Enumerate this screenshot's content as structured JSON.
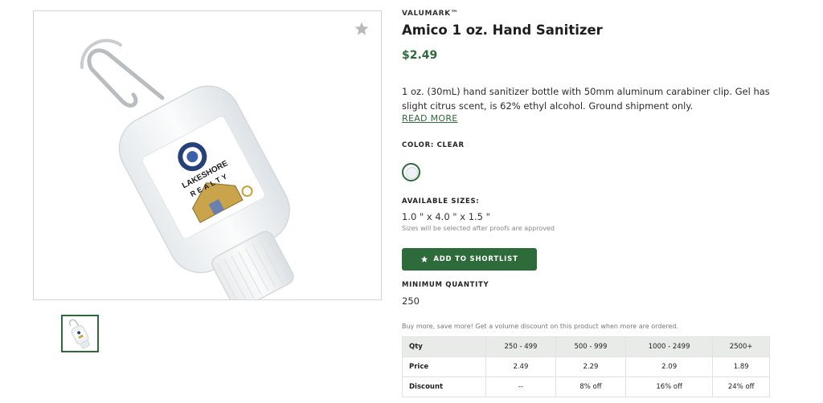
{
  "product": {
    "brand": "VALUMARK™",
    "title": "Amico 1 oz. Hand Sanitizer",
    "price": "$2.49",
    "description": "1 oz. (30mL) hand sanitizer bottle with 50mm aluminum carabiner clip. Gel has slight citrus scent, is 62% ethyl alcohol. Ground shipment only.",
    "read_more": "READ MORE",
    "image_logo_text_top": "LAKESHORE",
    "image_logo_text_bottom": "REALTY"
  },
  "color": {
    "label": "COLOR: CLEAR",
    "swatch_color": "#eef2f4"
  },
  "sizes": {
    "label": "AVAILABLE SIZES:",
    "value": "1.0 \" x 4.0 \" x 1.5 \"",
    "note": "Sizes will be selected after proofs are approved"
  },
  "actions": {
    "add_to_shortlist": "ADD TO SHORTLIST"
  },
  "minimum": {
    "label": "MINIMUM QUANTITY",
    "value": "250"
  },
  "pricing": {
    "intro": "Buy more, save more! Get a volume discount on this product when more are ordered.",
    "header": [
      "Qty",
      "250 - 499",
      "500 - 999",
      "1000 - 2499",
      "2500+"
    ],
    "rows": [
      [
        "Price",
        "2.49",
        "2.29",
        "2.09",
        "1.89"
      ],
      [
        "Discount",
        "--",
        "8% off",
        "16% off",
        "24% off"
      ]
    ]
  },
  "colors": {
    "accent": "#2e6b3a",
    "table_header_bg": "#e9ebe8"
  },
  "icons": {
    "favorite": "star-icon",
    "add": "star-icon"
  }
}
